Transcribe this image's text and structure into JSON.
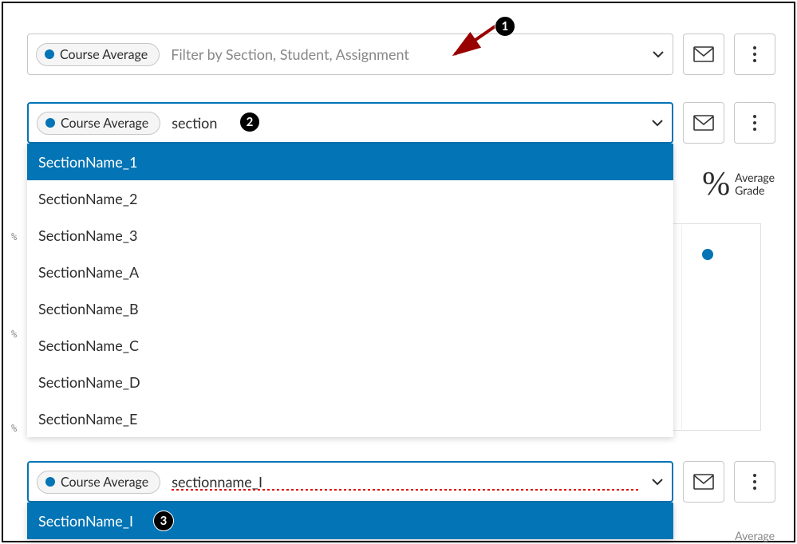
{
  "pill_label": "Course Average",
  "filter1": {
    "placeholder": "Filter by Section, Student, Assignment"
  },
  "filter2": {
    "typed": "section",
    "options": [
      "SectionName_1",
      "SectionName_2",
      "SectionName_3",
      "SectionName_A",
      "SectionName_B",
      "SectionName_C",
      "SectionName_D",
      "SectionName_E"
    ],
    "highlight_index": 0
  },
  "filter3": {
    "typed": "sectionname_I",
    "options": [
      "SectionName_I"
    ],
    "highlight_index": 0
  },
  "avg_label_top": "Average",
  "avg_label_bottom": "Grade",
  "pct_symbol": "%",
  "tick": "%",
  "annotations": {
    "a1": "1",
    "a2": "2",
    "a3": "3"
  }
}
